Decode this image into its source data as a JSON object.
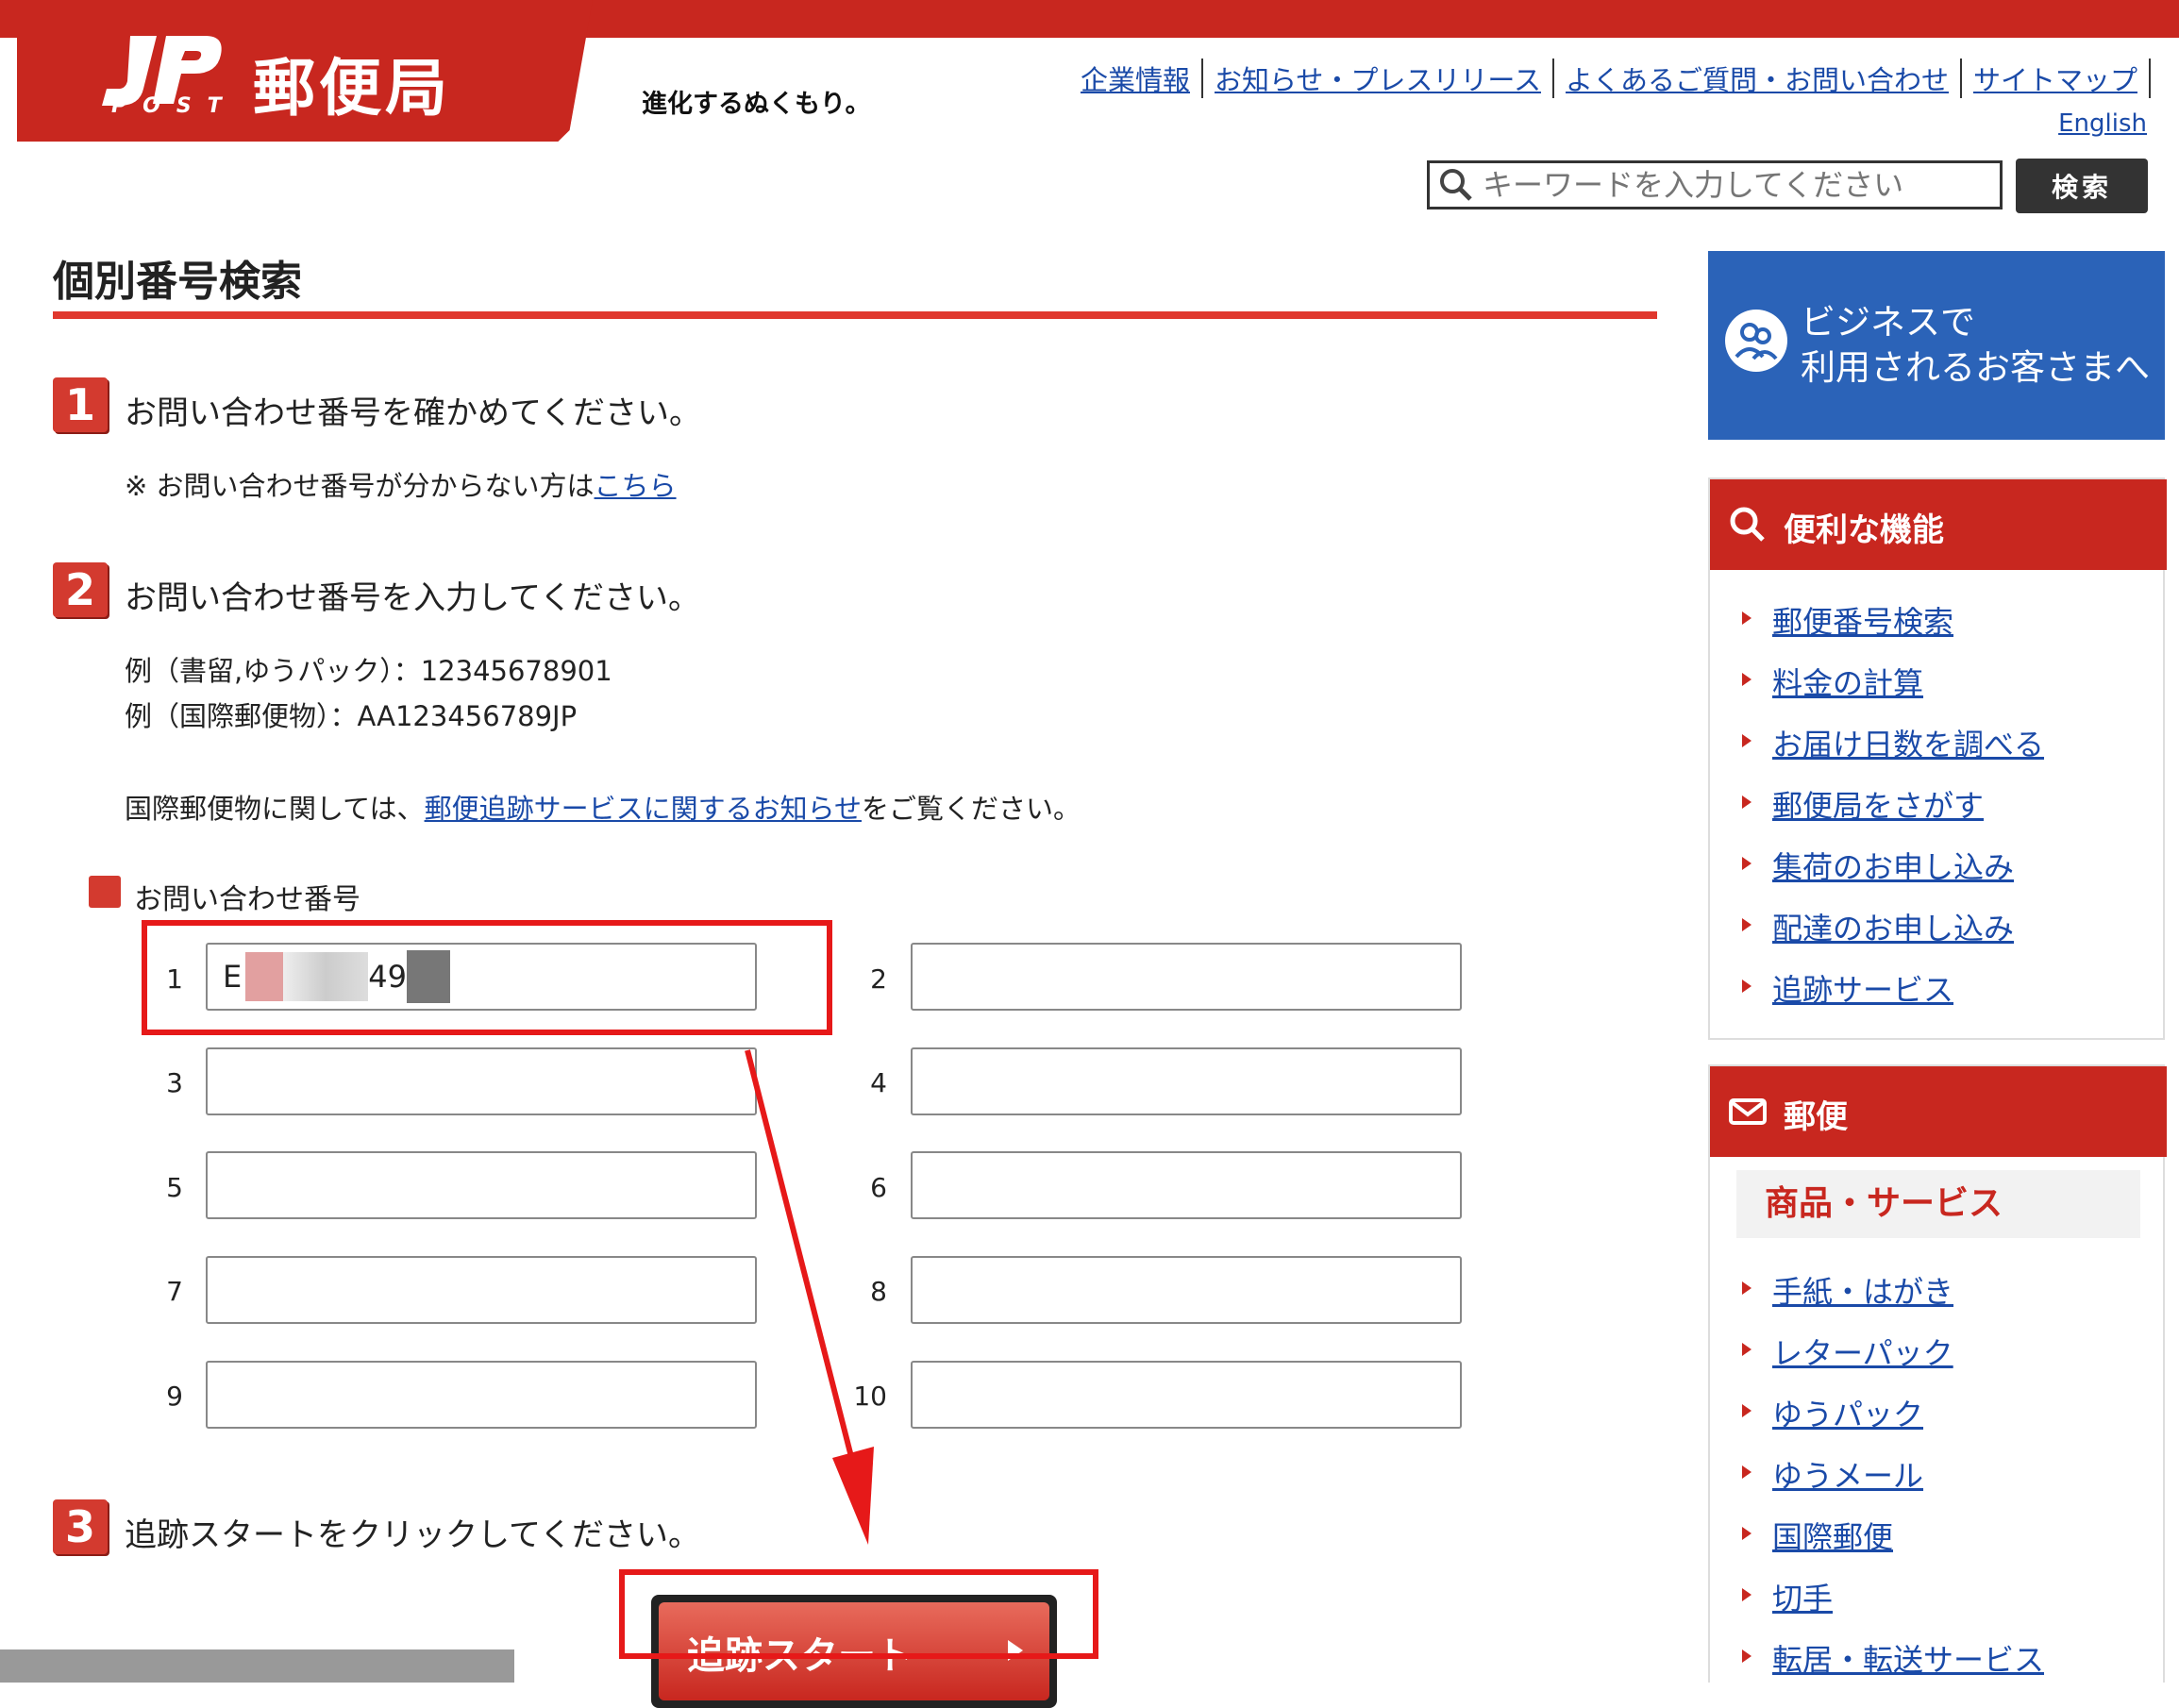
{
  "header": {
    "logo_text": "郵便局",
    "logo_sub": "POST",
    "tagline": "進化するぬくもり。",
    "links": [
      "企業情報",
      "お知らせ・プレスリリース",
      "よくあるご質問・お問い合わせ",
      "サイトマップ"
    ],
    "english": "English",
    "search_placeholder": "キーワードを入力してください",
    "search_button": "検索"
  },
  "main": {
    "page_title": "個別番号検索",
    "step1": {
      "num": "1",
      "text": "お問い合わせ番号を確かめてください。"
    },
    "note_prefix": "※ お問い合わせ番号が分からない方は",
    "note_link": "こちら",
    "step2": {
      "num": "2",
      "text": "お問い合わせ番号を入力してください。"
    },
    "example1": "例（書留,ゆうパック）：12345678901",
    "example2": "例（国際郵便物）：AA123456789JP",
    "intl_prefix": "国際郵便物に関しては、",
    "intl_link": "郵便追跡サービスに関するお知らせ",
    "intl_suffix": "をご覧ください。",
    "field_label": "お問い合わせ番号",
    "fields": [
      {
        "num": "1",
        "value_start": "E",
        "value_mid": "49"
      },
      {
        "num": "2",
        "value": ""
      },
      {
        "num": "3",
        "value": ""
      },
      {
        "num": "4",
        "value": ""
      },
      {
        "num": "5",
        "value": ""
      },
      {
        "num": "6",
        "value": ""
      },
      {
        "num": "7",
        "value": ""
      },
      {
        "num": "8",
        "value": ""
      },
      {
        "num": "9",
        "value": ""
      },
      {
        "num": "10",
        "value": ""
      }
    ],
    "step3": {
      "num": "3",
      "text": "追跡スタートをクリックしてください。"
    },
    "track_button": "追跡スタート"
  },
  "sidebar": {
    "business_banner": [
      "ビジネスで",
      "利用されるお客さまへ"
    ],
    "features": {
      "title": "便利な機能",
      "items": [
        "郵便番号検索",
        "料金の計算",
        "お届け日数を調べる",
        "郵便局をさがす",
        "集荷のお申し込み",
        "配達のお申し込み",
        "追跡サービス"
      ]
    },
    "mail": {
      "title": "郵便",
      "subhead": "商品・サービス",
      "items": [
        "手紙・はがき",
        "レターパック",
        "ゆうパック",
        "ゆうメール",
        "国際郵便",
        "切手",
        "転居・転送サービス"
      ]
    }
  },
  "colors": {
    "brand_red": "#c8271f",
    "link_blue": "#1a4aa8",
    "annotation_red": "#e61919",
    "banner_blue": "#2b63b8"
  }
}
